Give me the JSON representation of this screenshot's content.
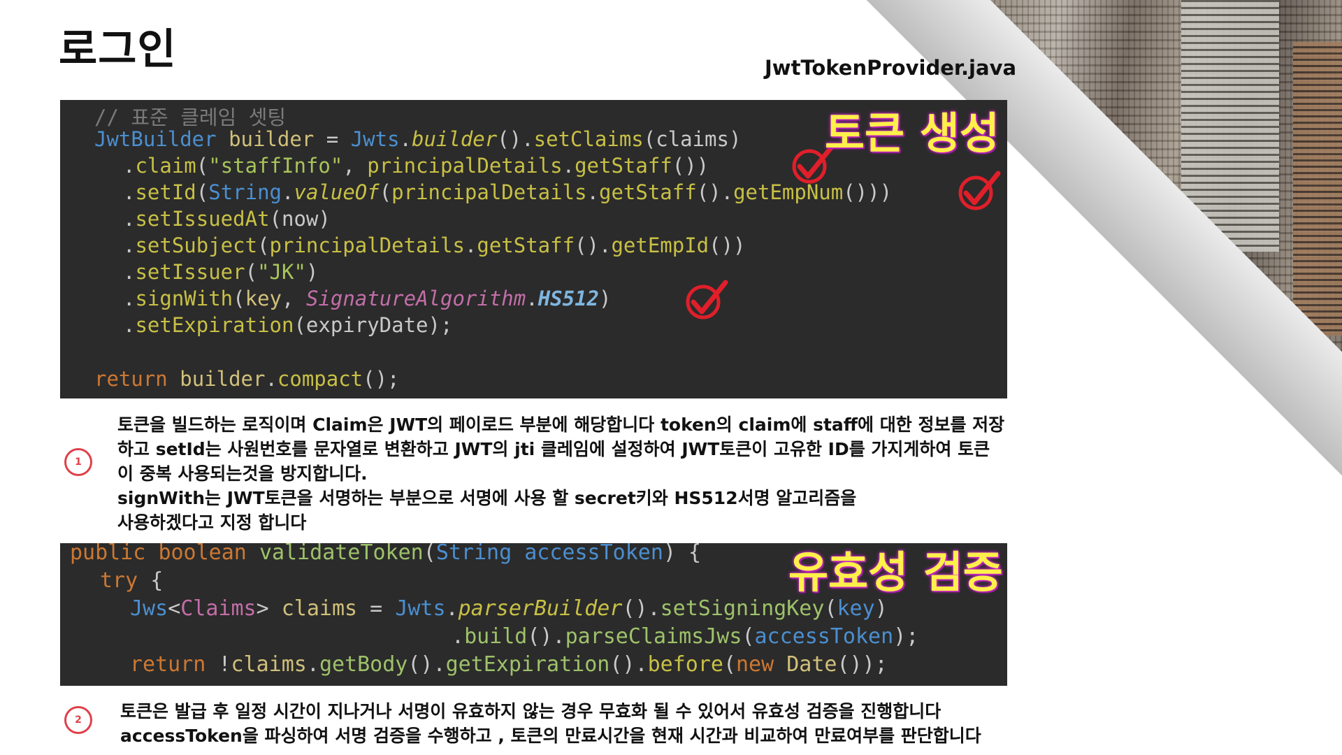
{
  "title": "로그인",
  "filename": "JwtTokenProvider.java",
  "overlay_labels": {
    "generate": "토큰 생성",
    "validate": "유효성 검증"
  },
  "code1_lines": [
    "// 표준 클레임 셋팅",
    "JwtBuilder builder = Jwts.builder().setClaims(claims)",
    ".claim(\"staffInfo\", principalDetails.getStaff())",
    ".setId(String.valueOf(principalDetails.getStaff().getEmpNum()))",
    ".setIssuedAt(now)",
    ".setSubject(principalDetails.getStaff().getEmpId())",
    ".setIssuer(\"JK\")",
    ".signWith(key, SignatureAlgorithm.HS512)",
    ".setExpiration(expiryDate);",
    "return builder.compact();"
  ],
  "code2_lines": [
    "public boolean validateToken(String accessToken) {",
    "try {",
    "Jws<Claims> claims = Jwts.parserBuilder().setSigningKey(key)",
    ".build().parseClaimsJws(accessToken);",
    "return !claims.getBody().getExpiration().before(new Date());"
  ],
  "badges": [
    "1",
    "2"
  ],
  "description1": [
    "토큰을 빌드하는 로직이며 Claim은 JWT의 페이로드 부분에 해당합니다 token의 claim에 staff에 대한 정보를 저장",
    "하고 setId는 사원번호를 문자열로 변환하고 JWT의 jti 클레임에 설정하여 JWT토큰이 고유한 ID를 가지게하여 토큰",
    "이 중복 사용되는것을 방지합니다.",
    "signWith는 JWT토큰을 서명하는 부분으로 서명에 사용 할 secret키와 HS512서명 알고리즘을",
    "사용하겠다고 지정 합니다"
  ],
  "description2": [
    "토큰은 발급 후 일정 시간이 지나거나 서명이 유효하지 않는 경우 무효화 될 수 있어서 유효성 검증을 진행합니다",
    "accessToken을 파싱하여 서명 검증을 수행하고 , 토큰의 만료시간을 현재 시간과 비교하여 만료여부를 판단합니다"
  ],
  "icons": [
    "check-mark-icon",
    "check-mark-icon",
    "check-mark-icon"
  ],
  "colors": {
    "code_bg": "#2b2b2b",
    "keyword": "#cc7832",
    "type": "#4b8fd0",
    "method": "#c8c045",
    "string": "#a8c45a",
    "overlay_text": "#fff04a",
    "overlay_glow": "#c020c0",
    "check": "#e01f2a"
  }
}
